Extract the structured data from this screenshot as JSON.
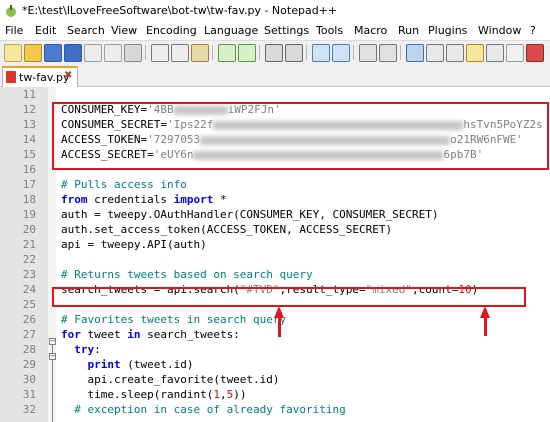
{
  "window": {
    "title": "*E:\\test\\ILoveFreeSoftware\\bot-tw\\tw-fav.py - Notepad++"
  },
  "menu": [
    "File",
    "Edit",
    "Search",
    "View",
    "Encoding",
    "Language",
    "Settings",
    "Tools",
    "Macro",
    "Run",
    "Plugins",
    "Window",
    "?"
  ],
  "tab": {
    "label": "tw-fav.py",
    "close": "✖"
  },
  "editor": {
    "lines": [
      {
        "n": "11"
      },
      {
        "n": "12",
        "parts": [
          {
            "t": "CONSUMER_KEY="
          },
          {
            "t": "'4BB",
            "c": "str"
          },
          {
            "blur": 54
          },
          {
            "t": "iWP2FJn'",
            "c": "str"
          }
        ]
      },
      {
        "n": "13",
        "parts": [
          {
            "t": "CONSUMER_SECRET="
          },
          {
            "t": "'Ips22f",
            "c": "str"
          },
          {
            "blur": 250
          },
          {
            "t": "hsTvn5PoYZ2s",
            "c": "str"
          }
        ]
      },
      {
        "n": "14",
        "parts": [
          {
            "t": "ACCESS_TOKEN="
          },
          {
            "t": "'7297053",
            "c": "str"
          },
          {
            "blur": 250
          },
          {
            "t": "o21RW6nFWE'",
            "c": "str"
          }
        ]
      },
      {
        "n": "15",
        "parts": [
          {
            "t": "ACCESS_SECRET="
          },
          {
            "t": "'eUY6n",
            "c": "str"
          },
          {
            "blur": 250
          },
          {
            "t": "6pb7B'",
            "c": "str"
          }
        ]
      },
      {
        "n": "16"
      },
      {
        "n": "17",
        "parts": [
          {
            "t": "# Pulls access info",
            "c": "cmt"
          }
        ]
      },
      {
        "n": "18",
        "parts": [
          {
            "t": "from",
            "c": "kw"
          },
          {
            "t": " credentials "
          },
          {
            "t": "import",
            "c": "kw"
          },
          {
            "t": " *"
          }
        ]
      },
      {
        "n": "19",
        "parts": [
          {
            "t": "auth = tweepy.OAuthHandler(CONSUMER_KEY, CONSUMER_SECRET)"
          }
        ]
      },
      {
        "n": "20",
        "parts": [
          {
            "t": "auth.set_access_token(ACCESS_TOKEN, ACCESS_SECRET)"
          }
        ]
      },
      {
        "n": "21",
        "parts": [
          {
            "t": "api = tweepy.API(auth)"
          }
        ]
      },
      {
        "n": "22"
      },
      {
        "n": "23",
        "parts": [
          {
            "t": "# Returns tweets based on search query",
            "c": "cmt"
          }
        ]
      },
      {
        "n": "24",
        "parts": [
          {
            "t": "search_tweets = api.search("
          },
          {
            "t": "\"#TVD\"",
            "c": "str"
          },
          {
            "t": ",result_type="
          },
          {
            "t": "\"mixed\"",
            "c": "str"
          },
          {
            "t": ",count="
          },
          {
            "t": "10",
            "c": "num"
          },
          {
            "t": ")"
          }
        ]
      },
      {
        "n": "25"
      },
      {
        "n": "26",
        "parts": [
          {
            "t": "# Favorites tweets in search query",
            "c": "cmt"
          }
        ]
      },
      {
        "n": "27",
        "parts": [
          {
            "t": "for",
            "c": "kw"
          },
          {
            "t": " tweet "
          },
          {
            "t": "in",
            "c": "kw"
          },
          {
            "t": " search_tweets:"
          }
        ]
      },
      {
        "n": "28",
        "parts": [
          {
            "t": "  "
          },
          {
            "t": "try",
            "c": "kw"
          },
          {
            "t": ":"
          }
        ]
      },
      {
        "n": "29",
        "parts": [
          {
            "t": "    "
          },
          {
            "t": "print",
            "c": "kw"
          },
          {
            "t": " (tweet.id)"
          }
        ]
      },
      {
        "n": "30",
        "parts": [
          {
            "t": "    api.create_favorite(tweet.id)"
          }
        ]
      },
      {
        "n": "31",
        "parts": [
          {
            "t": "    time.sleep(randint("
          },
          {
            "t": "1",
            "c": "num"
          },
          {
            "t": ","
          },
          {
            "t": "5",
            "c": "num"
          },
          {
            "t": "))"
          }
        ]
      },
      {
        "n": "32",
        "parts": [
          {
            "t": "  # exception in case of already favoriting",
            "c": "cmt"
          }
        ]
      }
    ]
  },
  "colors": {
    "highlight": "#e0151b",
    "comment": "#008080",
    "keyword": "#0000ff",
    "string": "#808080",
    "number": "#ff0000"
  }
}
